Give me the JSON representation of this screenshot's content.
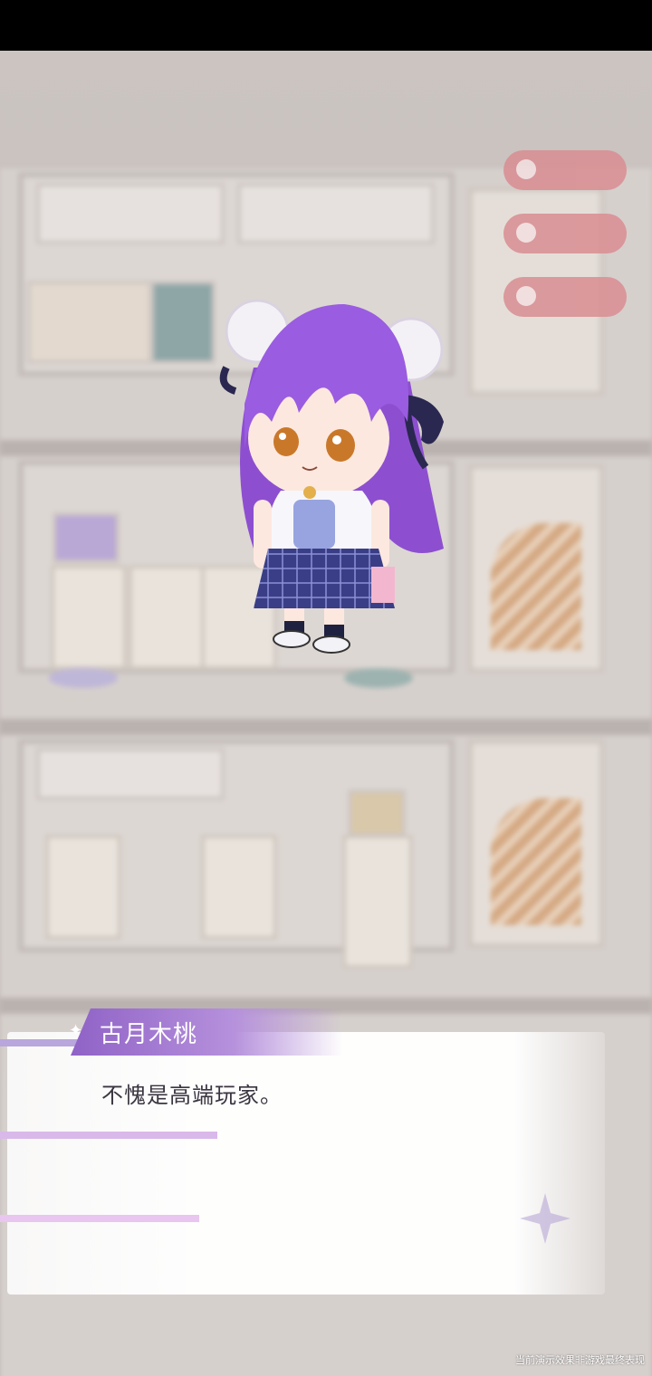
{
  "dialogue": {
    "speaker": "古月木桃",
    "line": "不愧是高端玩家。"
  },
  "footer": {
    "disclaimer": "当前演示效果非游戏最终表现"
  },
  "colors": {
    "name_tab": "#8f62c6",
    "accent_pink": "#d98d92",
    "background": "#c9c2bf"
  },
  "icons": [
    "character-sprite",
    "sparkle-icon",
    "star-deco-icon",
    "pill-button-icon"
  ]
}
